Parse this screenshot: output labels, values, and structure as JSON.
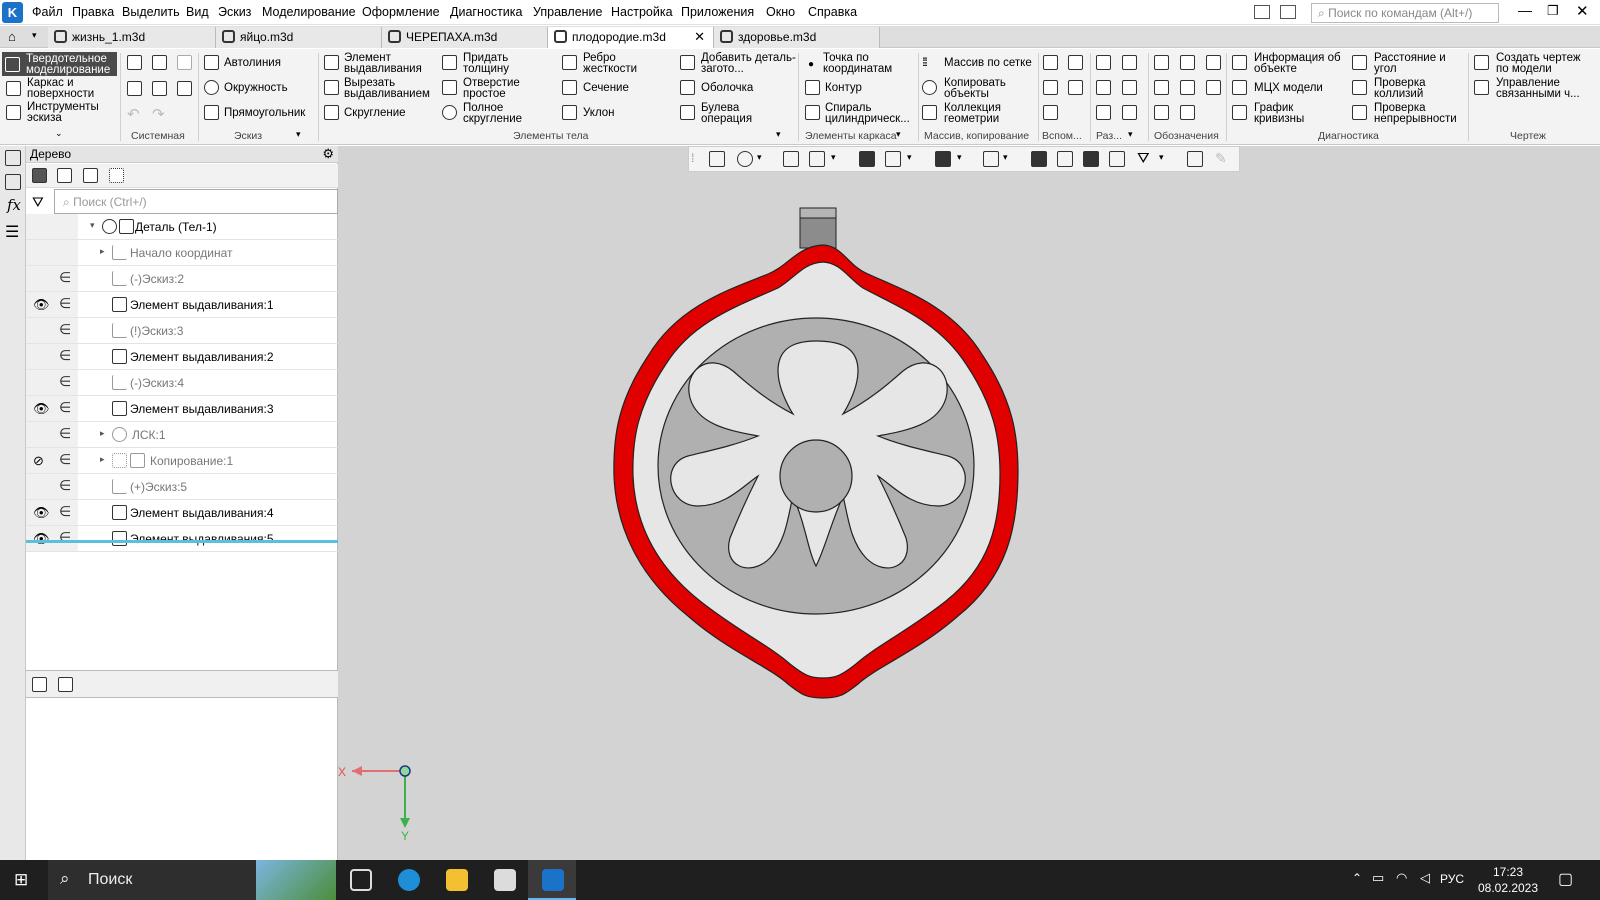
{
  "app": {
    "logo_letter": "K"
  },
  "menu": [
    "Файл",
    "Правка",
    "Выделить",
    "Вид",
    "Эскиз",
    "Моделирование",
    "Оформление",
    "Диагностика",
    "Управление",
    "Настройка",
    "Приложения",
    "Окно",
    "Справка"
  ],
  "command_search": {
    "placeholder": "Поиск по командам (Alt+/)"
  },
  "tabs": [
    {
      "label": "жизнь_1.m3d"
    },
    {
      "label": "яйцо.m3d"
    },
    {
      "label": "ЧЕРЕПАХА.m3d"
    },
    {
      "label": "плодородие.m3d"
    },
    {
      "label": "здоровье.m3d"
    }
  ],
  "active_tab_index": 3,
  "ribbon": {
    "modes": [
      "Твердотельное моделирование",
      "Каркас и поверхности",
      "Инструменты эскиза"
    ],
    "sketch": [
      "Автолиния",
      "Окружность",
      "Прямоугольник"
    ],
    "body_col1": [
      "Элемент выдавливания",
      "Вырезать выдавливанием",
      "Скругление"
    ],
    "body_col2": [
      "Придать толщину",
      "Отверстие простое",
      "Полное скругление"
    ],
    "body_col3": [
      "Ребро жесткости",
      "Сечение",
      "Уклон"
    ],
    "body_col4": [
      "Добавить деталь-загото...",
      "Оболочка",
      "Булева операция"
    ],
    "frame": [
      "Точка по координатам",
      "Контур",
      "Спираль цилиндрическ..."
    ],
    "array": [
      "Массив по сетке",
      "Копировать объекты",
      "Коллекция геометрии"
    ],
    "diag1": [
      "Информация об объекте",
      "МЦХ модели",
      "График кривизны"
    ],
    "diag2": [
      "Расстояние и угол",
      "Проверка коллизий",
      "Проверка непрерывности"
    ],
    "drawing": [
      "Создать чертеж по модели",
      "Управление связанными ч..."
    ],
    "groups": [
      "Системная",
      "Эскиз",
      "Элементы тела",
      "Элементы каркаса",
      "Массив, копирование",
      "Вспом...",
      "Раз...",
      "Обозначения",
      "Диагностика",
      "Чертеж"
    ]
  },
  "tree": {
    "title": "Дерево",
    "search_placeholder": "Поиск (Ctrl+/)",
    "items": [
      {
        "label": "Деталь (Тел-1)",
        "eye": "",
        "el": "",
        "arrow": "▾"
      },
      {
        "label": "Начало координат",
        "eye": "",
        "el": "",
        "arrow": "▸"
      },
      {
        "label": "(-)Эскиз:2",
        "eye": "",
        "el": "∈",
        "arrow": ""
      },
      {
        "label": "Элемент выдавливания:1",
        "eye": "👁",
        "el": "∈",
        "arrow": ""
      },
      {
        "label": "(!)Эскиз:3",
        "eye": "",
        "el": "∈",
        "arrow": ""
      },
      {
        "label": "Элемент выдавливания:2",
        "eye": "",
        "el": "∈",
        "arrow": ""
      },
      {
        "label": "(-)Эскиз:4",
        "eye": "",
        "el": "∈",
        "arrow": ""
      },
      {
        "label": "Элемент выдавливания:3",
        "eye": "👁",
        "el": "∈",
        "arrow": ""
      },
      {
        "label": "ЛСК:1",
        "eye": "",
        "el": "∈",
        "arrow": "▸"
      },
      {
        "label": "Копирование:1",
        "eye": "⊘",
        "el": "∈",
        "arrow": "▸"
      },
      {
        "label": "(+)Эскиз:5",
        "eye": "",
        "el": "∈",
        "arrow": ""
      },
      {
        "label": "Элемент выдавливания:4",
        "eye": "👁",
        "el": "∈",
        "arrow": ""
      },
      {
        "label": "Элемент выдавливания:5",
        "eye": "👁",
        "el": "∈",
        "arrow": ""
      }
    ]
  },
  "axes": {
    "x": "X",
    "y": "Y"
  },
  "taskbar": {
    "search": "Поиск",
    "lang": "РУС",
    "time": "17:23",
    "date": "08.02.2023"
  },
  "colors": {
    "shell": "#e00000",
    "body": "#e6e6e6",
    "inset": "#b0b0b0",
    "viewport": "#d3d3d3"
  }
}
